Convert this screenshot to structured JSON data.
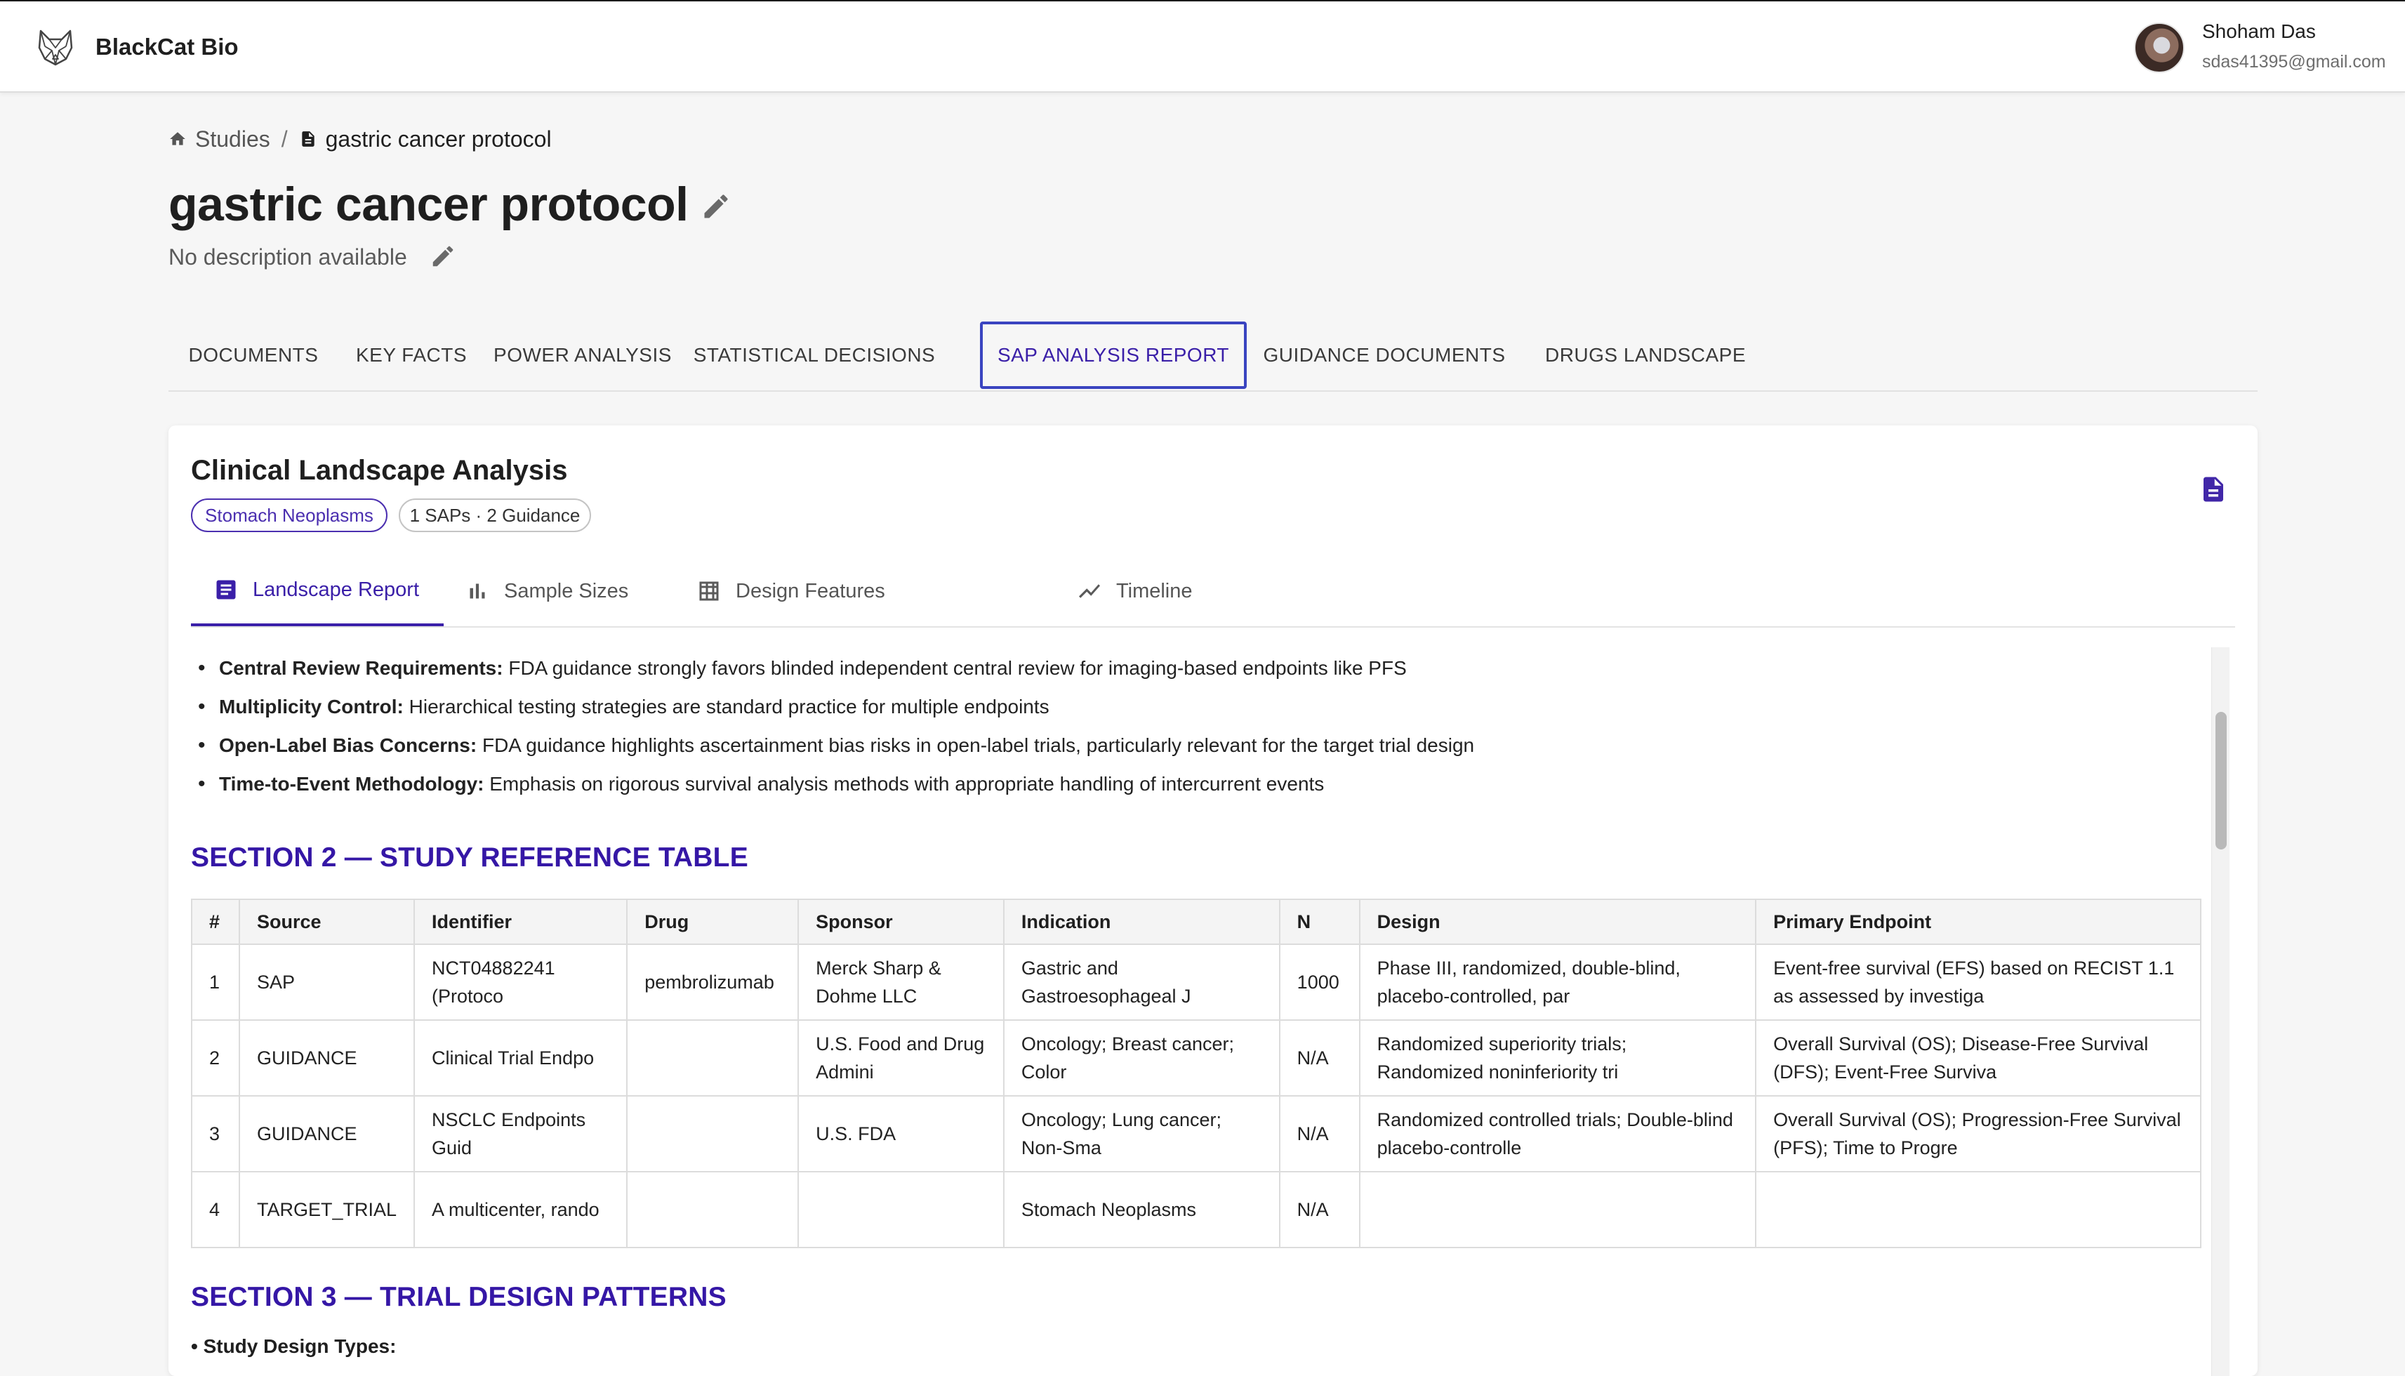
{
  "app": {
    "brand": "BlackCat Bio"
  },
  "user": {
    "name": "Shoham Das",
    "email": "sdas41395@gmail.com"
  },
  "breadcrumb": {
    "home": "Studies",
    "separator": "/",
    "current": "gastric cancer protocol"
  },
  "page": {
    "title": "gastric cancer protocol",
    "description": "No description available"
  },
  "main_tabs": [
    {
      "label": "DOCUMENTS"
    },
    {
      "label": "KEY FACTS"
    },
    {
      "label": "POWER ANALYSIS"
    },
    {
      "label": "STATISTICAL DECISIONS"
    },
    {
      "label": "SAP ANALYSIS REPORT",
      "active": true
    },
    {
      "label": "GUIDANCE DOCUMENTS"
    },
    {
      "label": "DRUGS LANDSCAPE"
    }
  ],
  "card": {
    "title": "Clinical Landscape Analysis",
    "chips": [
      "Stomach Neoplasms",
      "1 SAPs · 2 Guidance"
    ],
    "sub_tabs": [
      {
        "label": "Landscape Report",
        "icon": "article-icon",
        "active": true
      },
      {
        "label": "Sample Sizes",
        "icon": "bar-chart-icon"
      },
      {
        "label": "Design Features",
        "icon": "grid-icon"
      },
      {
        "label": "Timeline",
        "icon": "trend-line-icon"
      }
    ]
  },
  "report": {
    "bullets": [
      {
        "term": "Central Review Requirements:",
        "text": " FDA guidance strongly favors blinded independent central review for imaging-based endpoints like PFS"
      },
      {
        "term": "Multiplicity Control:",
        "text": " Hierarchical testing strategies are standard practice for multiple endpoints"
      },
      {
        "term": "Open-Label Bias Concerns:",
        "text": " FDA guidance highlights ascertainment bias risks in open-label trials, particularly relevant for the target trial design"
      },
      {
        "term": "Time-to-Event Methodology:",
        "text": " Emphasis on rigorous survival analysis methods with appropriate handling of intercurrent events"
      }
    ],
    "section2_title": "SECTION 2 — STUDY REFERENCE TABLE",
    "table": {
      "headers": [
        "#",
        "Source",
        "Identifier",
        "Drug",
        "Sponsor",
        "Indication",
        "N",
        "Design",
        "Primary Endpoint"
      ],
      "rows": [
        [
          "1",
          "SAP",
          "NCT04882241 (Protoco",
          "pembrolizumab",
          "Merck Sharp & Dohme LLC",
          "Gastric and Gastroesophageal J",
          "1000",
          "Phase III, randomized, double-blind, placebo-controlled, par",
          "Event-free survival (EFS) based on RECIST 1.1 as assessed by investiga"
        ],
        [
          "2",
          "GUIDANCE",
          "Clinical Trial Endpo",
          "",
          "U.S. Food and Drug Admini",
          "Oncology; Breast cancer; Color",
          "N/A",
          "Randomized superiority trials; Randomized noninferiority tri",
          "Overall Survival (OS); Disease-Free Survival (DFS); Event-Free Surviva"
        ],
        [
          "3",
          "GUIDANCE",
          "NSCLC Endpoints Guid",
          "",
          "U.S. FDA",
          "Oncology; Lung cancer; Non-Sma",
          "N/A",
          "Randomized controlled trials; Double-blind placebo-controlle",
          "Overall Survival (OS); Progression-Free Survival (PFS); Time to Progre"
        ],
        [
          "4",
          "TARGET_TRIAL",
          "A multicenter, rando",
          "",
          "",
          "Stomach Neoplasms",
          "N/A",
          "",
          ""
        ]
      ]
    },
    "section3_title": "SECTION 3 — TRIAL DESIGN PATTERNS",
    "design_types_label": "• Study Design Types:"
  },
  "colors": {
    "accent": "#3a1fa8",
    "section_heading": "#3517a6",
    "chip_border": "#4b2fb0"
  }
}
